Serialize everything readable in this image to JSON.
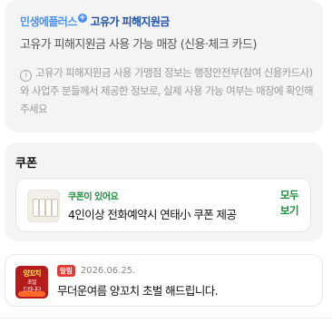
{
  "subsidy": {
    "brand_name": "민생에플러스",
    "brand_plus": "+",
    "program_name": "고유가 피해지원금",
    "subtitle": "고유가 피해지원금 사용 가능 매장 (신용·체크 카드)",
    "info_icon": "ⓘ",
    "notice": "고유가 피해지원금 사용 가맹점 정보는 행정안전부(참여 신용카드사)와 사업주 분들께서 제공한 정보로, 실제 사용 가능 여부는 매장에 확인해주세요"
  },
  "coupons": {
    "title": "쿠폰",
    "badge": "쿠폰이 있어요",
    "text": "4인이상 전화예약시 연태小 쿠폰 제공",
    "view_all_line1": "모두",
    "view_all_line2": "보기"
  },
  "post": {
    "thumb_line1": "양꼬치",
    "thumb_line2": "초벌",
    "thumb_line3": "드립니다",
    "badge": "알림",
    "date": "2026.06.25.",
    "text": "무더운여름 양꼬치 초벌 해드립니다."
  },
  "colors": {
    "brand_blue": "#4a90f2",
    "program_navy": "#1e4fa8",
    "coupon_green": "#1a8f3c",
    "event_red": "#e53935"
  }
}
